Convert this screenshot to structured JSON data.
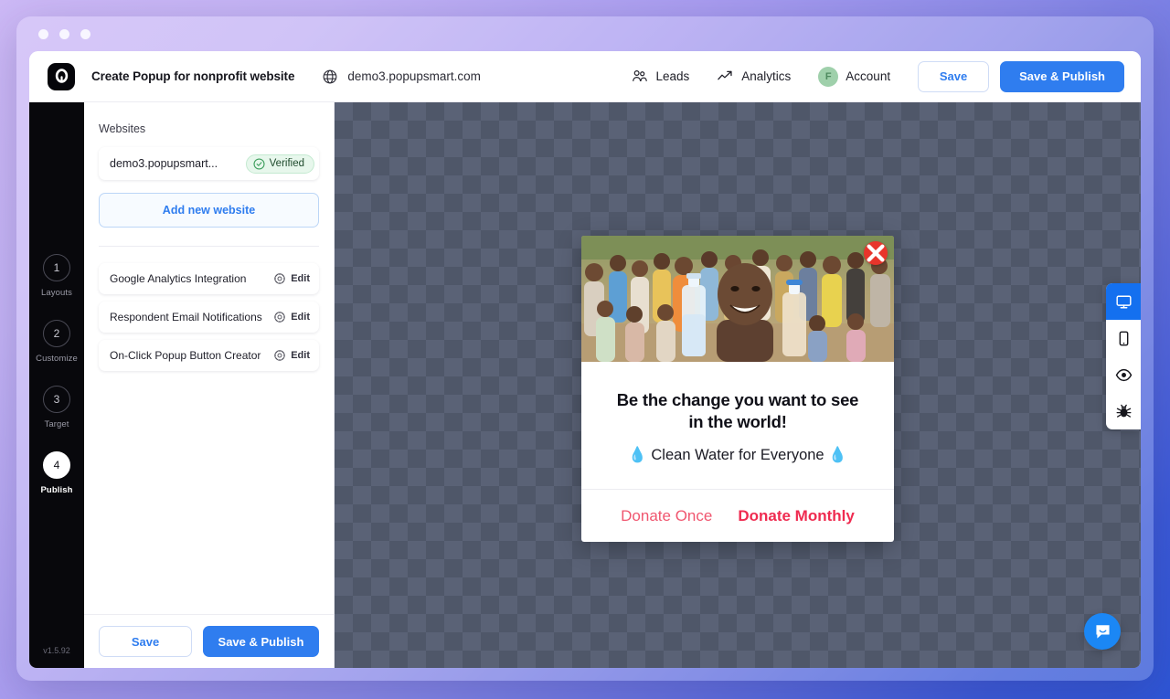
{
  "window": {
    "traffic_lights": [
      "close",
      "minimize",
      "maximize"
    ]
  },
  "topbar": {
    "logo_icon": "popupsmart-logo-icon",
    "doc_title": "Create Popup for nonprofit website",
    "globe_icon": "globe-icon",
    "site_url": "demo3.popupsmart.com",
    "nav": [
      {
        "label": "Leads",
        "icon": "users-icon"
      },
      {
        "label": "Analytics",
        "icon": "analytics-trend-icon"
      }
    ],
    "account": {
      "label": "Account",
      "avatar_initial": "F",
      "avatar_color": "#9fd0ab"
    },
    "save_label": "Save",
    "save_publish_label": "Save & Publish"
  },
  "rail": {
    "steps": [
      {
        "number": "1",
        "label": "Layouts",
        "active": false
      },
      {
        "number": "2",
        "label": "Customize",
        "active": false
      },
      {
        "number": "3",
        "label": "Target",
        "active": false
      },
      {
        "number": "4",
        "label": "Publish",
        "active": true
      }
    ],
    "version": "v1.5.92"
  },
  "panel": {
    "websites_label": "Websites",
    "website": {
      "name": "demo3.popupsmart...",
      "badge_label": "Verified",
      "badge_icon": "check-circle-icon",
      "badge_color": "#1e4a2c"
    },
    "add_website_label": "Add new website",
    "settings": [
      {
        "name": "Google Analytics Integration",
        "edit_label": "Edit",
        "icon": "gear-icon"
      },
      {
        "name": "Respondent Email Notifications",
        "edit_label": "Edit",
        "icon": "gear-icon"
      },
      {
        "name": "On-Click Popup Button Creator",
        "edit_label": "Edit",
        "icon": "gear-icon"
      }
    ],
    "footer": {
      "save_label": "Save",
      "save_publish_label": "Save & Publish"
    }
  },
  "canvas": {
    "popup": {
      "close_icon": "close-x-icon",
      "image_alt": "group-of-smiling-children-holding-water-bottles",
      "headline_line1": "Be the change you want to see",
      "headline_line2": "in the world!",
      "subtext": "💧 Clean Water for Everyone 💧",
      "cta_once": "Donate Once",
      "cta_monthly": "Donate Monthly",
      "cta_once_color": "#f0566f",
      "cta_monthly_color": "#ef2b50"
    },
    "device_toolbar": [
      {
        "icon": "desktop-icon",
        "active": true,
        "indicator": true
      },
      {
        "icon": "mobile-icon",
        "active": false,
        "indicator": true
      },
      {
        "icon": "eye-preview-icon",
        "active": false,
        "indicator": false
      },
      {
        "icon": "bug-debug-icon",
        "active": false,
        "indicator": false
      }
    ],
    "chat_launcher_icon": "chat-bubble-icon"
  },
  "colors": {
    "accent_blue": "#2f7def",
    "rail_black": "#08080c",
    "verified_green": "#3ddb4a",
    "danger_red": "#e8352b"
  }
}
